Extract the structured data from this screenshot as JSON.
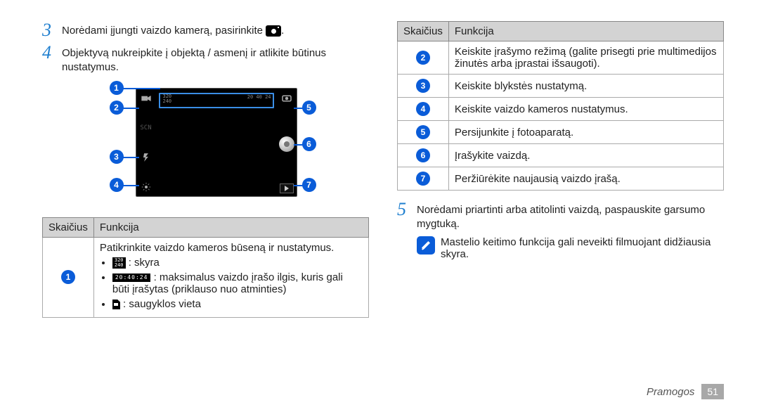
{
  "steps_left": {
    "s3": {
      "num": "3",
      "text_before": "Norėdami įjungti vaizdo kamerą, pasirinkite ",
      "text_after": "."
    },
    "s4": {
      "num": "4",
      "text": "Objektyvą nukreipkite į objektą / asmenį ir atlikite būtinus nustatymus."
    }
  },
  "table_left": {
    "h1": "Skaičius",
    "h2": "Funkcija",
    "row1": {
      "num": "1",
      "intro": "Patikrinkite vaizdo kameros būseną ir nustatymus.",
      "bullet1_label": "skyra",
      "bullet1_icon_top": "320",
      "bullet1_icon_bot": "240",
      "bullet2_icon": "20:40:24",
      "bullet2_text": "maksimalus vaizdo įrašo ilgis, kuris gali būti įrašytas (priklauso nuo atminties)",
      "bullet3_text": "saugyklos vieta"
    }
  },
  "table_right": {
    "h1": "Skaičius",
    "h2": "Funkcija",
    "rows": [
      {
        "num": "2",
        "text": "Keiskite įrašymo režimą (galite prisegti prie multimedijos žinutės arba įprastai išsaugoti)."
      },
      {
        "num": "3",
        "text": "Keiskite blykstės nustatymą."
      },
      {
        "num": "4",
        "text": "Keiskite vaizdo kameros nustatymus."
      },
      {
        "num": "5",
        "text": "Persijunkite į fotoaparatą."
      },
      {
        "num": "6",
        "text": "Įrašykite vaizdą."
      },
      {
        "num": "7",
        "text": "Peržiūrėkite naujausią vaizdo įrašą."
      }
    ]
  },
  "steps_right": {
    "s5": {
      "num": "5",
      "text": "Norėdami priartinti arba atitolinti vaizdą, paspauskite garsumo mygtuką."
    },
    "note": "Mastelio keitimo funkcija gali neveikti filmuojant didžiausia skyra."
  },
  "diagram": {
    "c1": "1",
    "c2": "2",
    "c3": "3",
    "c4": "4",
    "c5": "5",
    "c6": "6",
    "c7": "7",
    "hdr": "20 40 24",
    "res_top": "320",
    "res_bot": "240"
  },
  "footer": {
    "section": "Pramogos",
    "page": "51"
  }
}
